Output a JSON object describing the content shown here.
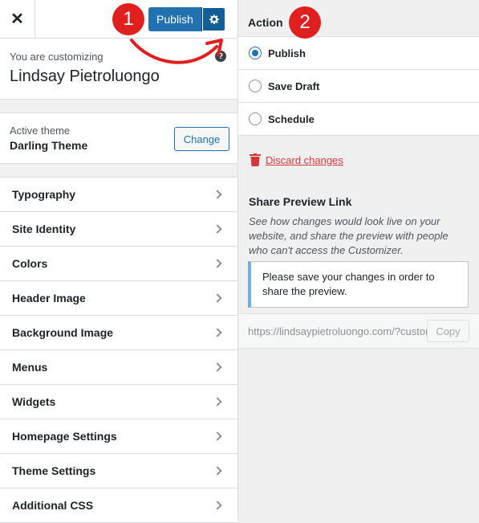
{
  "header": {
    "close_icon": "close-icon",
    "publish_label": "Publish",
    "gear_icon": "gear-icon"
  },
  "annotations": {
    "step1": "1",
    "step2": "2",
    "color": "#e01f1f"
  },
  "customizing": {
    "label": "You are customizing",
    "site_name": "Lindsay Pietroluongo"
  },
  "theme": {
    "label": "Active theme",
    "name": "Darling Theme",
    "change_label": "Change"
  },
  "menu": {
    "items": [
      {
        "label": "Typography"
      },
      {
        "label": "Site Identity"
      },
      {
        "label": "Colors"
      },
      {
        "label": "Header Image"
      },
      {
        "label": "Background Image"
      },
      {
        "label": "Menus"
      },
      {
        "label": "Widgets"
      },
      {
        "label": "Homepage Settings"
      },
      {
        "label": "Theme Settings"
      },
      {
        "label": "Additional CSS"
      }
    ]
  },
  "action": {
    "title": "Action",
    "options": [
      {
        "label": "Publish",
        "selected": true
      },
      {
        "label": "Save Draft",
        "selected": false
      },
      {
        "label": "Schedule",
        "selected": false
      }
    ],
    "discard_label": "Discard changes"
  },
  "share": {
    "title": "Share Preview Link",
    "description": "See how changes would look live on your website, and share the preview with people who can't access the Customizer.",
    "notice": "Please save your changes in order to share the preview.",
    "url": "https://lindsaypietroluongo.com/?customize_changeset_uuid",
    "copy_label": "Copy"
  },
  "colors": {
    "primary": "#2271b1",
    "danger": "#d63638"
  }
}
